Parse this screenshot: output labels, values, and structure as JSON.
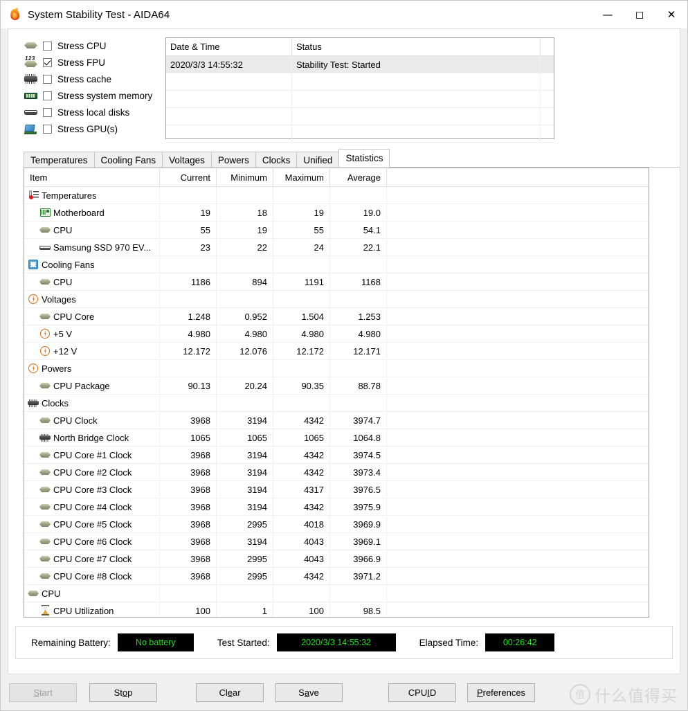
{
  "window": {
    "title": "System Stability Test - AIDA64",
    "app_icon": "flame-icon",
    "minimize": "—",
    "maximize": "☐",
    "close": "✕"
  },
  "stress_options": [
    {
      "label": "Stress CPU",
      "icon": "cpu-icon",
      "checked": false
    },
    {
      "label": "Stress FPU",
      "icon": "fpu-icon",
      "checked": true
    },
    {
      "label": "Stress cache",
      "icon": "cache-icon",
      "checked": false
    },
    {
      "label": "Stress system memory",
      "icon": "memory-icon",
      "checked": false
    },
    {
      "label": "Stress local disks",
      "icon": "disk-icon",
      "checked": false
    },
    {
      "label": "Stress GPU(s)",
      "icon": "gpu-icon",
      "checked": false
    }
  ],
  "log_table": {
    "columns": [
      "Date & Time",
      "Status",
      ""
    ],
    "rows": [
      {
        "datetime": "2020/3/3 14:55:32",
        "status": "Stability Test: Started",
        "selected": true
      },
      {
        "datetime": "",
        "status": "",
        "selected": false
      },
      {
        "datetime": "",
        "status": "",
        "selected": false
      },
      {
        "datetime": "",
        "status": "",
        "selected": false
      },
      {
        "datetime": "",
        "status": "",
        "selected": false
      }
    ]
  },
  "tabs": [
    {
      "label": "Temperatures",
      "active": false
    },
    {
      "label": "Cooling Fans",
      "active": false
    },
    {
      "label": "Voltages",
      "active": false
    },
    {
      "label": "Powers",
      "active": false
    },
    {
      "label": "Clocks",
      "active": false
    },
    {
      "label": "Unified",
      "active": false
    },
    {
      "label": "Statistics",
      "active": true
    }
  ],
  "statistics": {
    "columns": [
      "Item",
      "Current",
      "Minimum",
      "Maximum",
      "Average"
    ],
    "rows": [
      {
        "item": "Temperatures",
        "icon": "thermometer-icon",
        "group": true,
        "current": "",
        "minimum": "",
        "maximum": "",
        "average": ""
      },
      {
        "item": "Motherboard",
        "icon": "motherboard-icon",
        "group": false,
        "current": "19",
        "minimum": "18",
        "maximum": "19",
        "average": "19.0"
      },
      {
        "item": "CPU",
        "icon": "cpu-icon",
        "group": false,
        "current": "55",
        "minimum": "19",
        "maximum": "55",
        "average": "54.1"
      },
      {
        "item": "Samsung SSD 970 EV...",
        "icon": "disk-icon",
        "group": false,
        "current": "23",
        "minimum": "22",
        "maximum": "24",
        "average": "22.1"
      },
      {
        "item": "Cooling Fans",
        "icon": "fan-icon",
        "group": true,
        "current": "",
        "minimum": "",
        "maximum": "",
        "average": ""
      },
      {
        "item": "CPU",
        "icon": "cpu-icon",
        "group": false,
        "current": "1186",
        "minimum": "894",
        "maximum": "1191",
        "average": "1168"
      },
      {
        "item": "Voltages",
        "icon": "voltage-icon",
        "group": true,
        "current": "",
        "minimum": "",
        "maximum": "",
        "average": ""
      },
      {
        "item": "CPU Core",
        "icon": "cpu-icon",
        "group": false,
        "current": "1.248",
        "minimum": "0.952",
        "maximum": "1.504",
        "average": "1.253"
      },
      {
        "item": "+5 V",
        "icon": "voltage-icon",
        "group": false,
        "current": "4.980",
        "minimum": "4.980",
        "maximum": "4.980",
        "average": "4.980"
      },
      {
        "item": "+12 V",
        "icon": "voltage-icon",
        "group": false,
        "current": "12.172",
        "minimum": "12.076",
        "maximum": "12.172",
        "average": "12.171"
      },
      {
        "item": "Powers",
        "icon": "voltage-icon",
        "group": true,
        "current": "",
        "minimum": "",
        "maximum": "",
        "average": ""
      },
      {
        "item": "CPU Package",
        "icon": "cpu-icon",
        "group": false,
        "current": "90.13",
        "minimum": "20.24",
        "maximum": "90.35",
        "average": "88.78"
      },
      {
        "item": "Clocks",
        "icon": "chip-icon",
        "group": true,
        "current": "",
        "minimum": "",
        "maximum": "",
        "average": ""
      },
      {
        "item": "CPU Clock",
        "icon": "cpu-icon",
        "group": false,
        "current": "3968",
        "minimum": "3194",
        "maximum": "4342",
        "average": "3974.7"
      },
      {
        "item": "North Bridge Clock",
        "icon": "chip-icon",
        "group": false,
        "current": "1065",
        "minimum": "1065",
        "maximum": "1065",
        "average": "1064.8"
      },
      {
        "item": "CPU Core #1 Clock",
        "icon": "cpu-icon",
        "group": false,
        "current": "3968",
        "minimum": "3194",
        "maximum": "4342",
        "average": "3974.5"
      },
      {
        "item": "CPU Core #2 Clock",
        "icon": "cpu-icon",
        "group": false,
        "current": "3968",
        "minimum": "3194",
        "maximum": "4342",
        "average": "3973.4"
      },
      {
        "item": "CPU Core #3 Clock",
        "icon": "cpu-icon",
        "group": false,
        "current": "3968",
        "minimum": "3194",
        "maximum": "4317",
        "average": "3976.5"
      },
      {
        "item": "CPU Core #4 Clock",
        "icon": "cpu-icon",
        "group": false,
        "current": "3968",
        "minimum": "3194",
        "maximum": "4342",
        "average": "3975.9"
      },
      {
        "item": "CPU Core #5 Clock",
        "icon": "cpu-icon",
        "group": false,
        "current": "3968",
        "minimum": "2995",
        "maximum": "4018",
        "average": "3969.9"
      },
      {
        "item": "CPU Core #6 Clock",
        "icon": "cpu-icon",
        "group": false,
        "current": "3968",
        "minimum": "3194",
        "maximum": "4043",
        "average": "3969.1"
      },
      {
        "item": "CPU Core #7 Clock",
        "icon": "cpu-icon",
        "group": false,
        "current": "3968",
        "minimum": "2995",
        "maximum": "4043",
        "average": "3966.9"
      },
      {
        "item": "CPU Core #8 Clock",
        "icon": "cpu-icon",
        "group": false,
        "current": "3968",
        "minimum": "2995",
        "maximum": "4342",
        "average": "3971.2"
      },
      {
        "item": "CPU",
        "icon": "cpu-icon",
        "group": true,
        "current": "",
        "minimum": "",
        "maximum": "",
        "average": ""
      },
      {
        "item": "CPU Utilization",
        "icon": "hourglass-icon",
        "group": false,
        "current": "100",
        "minimum": "1",
        "maximum": "100",
        "average": "98.5"
      },
      {
        "item": "",
        "icon": "",
        "group": true,
        "current": "",
        "minimum": "",
        "maximum": "",
        "average": ""
      }
    ]
  },
  "status_bar": {
    "battery_label": "Remaining Battery:",
    "battery_value": "No battery",
    "started_label": "Test Started:",
    "started_value": "2020/3/3 14:55:32",
    "elapsed_label": "Elapsed Time:",
    "elapsed_value": "00:26:42",
    "led_color": "#22dd22",
    "led_bg": "#000000"
  },
  "buttons": [
    {
      "name": "start",
      "pre": "",
      "mn": "S",
      "post": "tart",
      "disabled": true
    },
    {
      "name": "stop",
      "pre": "St",
      "mn": "o",
      "post": "p",
      "disabled": false
    },
    {
      "name": "clear",
      "pre": "Cl",
      "mn": "e",
      "post": "ar",
      "disabled": false
    },
    {
      "name": "save",
      "pre": "S",
      "mn": "a",
      "post": "ve",
      "disabled": false
    },
    {
      "name": "cpuid",
      "pre": "CPU",
      "mn": "I",
      "post": "D",
      "disabled": false
    },
    {
      "name": "preferences",
      "pre": "",
      "mn": "P",
      "post": "references",
      "disabled": false
    }
  ],
  "watermark": {
    "mark": "值",
    "text": "什么值得买"
  }
}
